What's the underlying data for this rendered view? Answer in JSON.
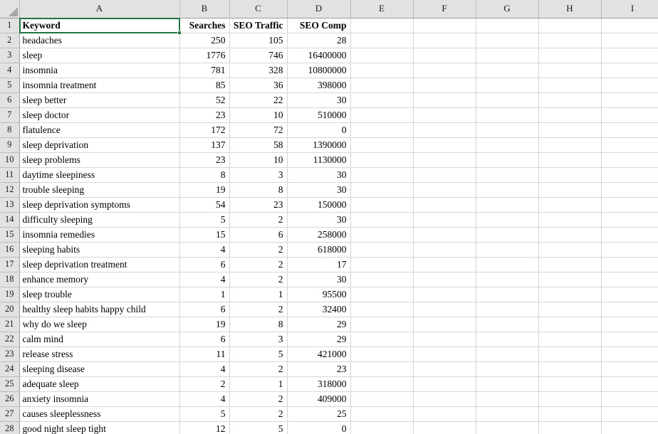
{
  "app": {
    "type": "spreadsheet",
    "select_all_label": "Select All",
    "active_cell": "A1",
    "selection_color": "#217346",
    "header_bg": "#e2e2e2",
    "gridline_color": "#d6d6d6"
  },
  "columns": [
    {
      "id": "A",
      "label": "A"
    },
    {
      "id": "B",
      "label": "B"
    },
    {
      "id": "C",
      "label": "C"
    },
    {
      "id": "D",
      "label": "D"
    },
    {
      "id": "E",
      "label": "E"
    },
    {
      "id": "F",
      "label": "F"
    },
    {
      "id": "G",
      "label": "G"
    },
    {
      "id": "H",
      "label": "H"
    },
    {
      "id": "I",
      "label": "I"
    }
  ],
  "header_row": {
    "number": "1",
    "cells": [
      "Keyword",
      "Searches",
      "SEO Traffic",
      "SEO Comp",
      "",
      "",
      "",
      "",
      ""
    ]
  },
  "rows": [
    {
      "number": "2",
      "cells": [
        "headaches",
        "250",
        "105",
        "28",
        "",
        "",
        "",
        "",
        ""
      ]
    },
    {
      "number": "3",
      "cells": [
        "sleep",
        "1776",
        "746",
        "16400000",
        "",
        "",
        "",
        "",
        ""
      ]
    },
    {
      "number": "4",
      "cells": [
        "insomnia",
        "781",
        "328",
        "10800000",
        "",
        "",
        "",
        "",
        ""
      ]
    },
    {
      "number": "5",
      "cells": [
        "insomnia treatment",
        "85",
        "36",
        "398000",
        "",
        "",
        "",
        "",
        ""
      ]
    },
    {
      "number": "6",
      "cells": [
        "sleep better",
        "52",
        "22",
        "30",
        "",
        "",
        "",
        "",
        ""
      ]
    },
    {
      "number": "7",
      "cells": [
        "sleep doctor",
        "23",
        "10",
        "510000",
        "",
        "",
        "",
        "",
        ""
      ]
    },
    {
      "number": "8",
      "cells": [
        "flatulence",
        "172",
        "72",
        "0",
        "",
        "",
        "",
        "",
        ""
      ]
    },
    {
      "number": "9",
      "cells": [
        "sleep deprivation",
        "137",
        "58",
        "1390000",
        "",
        "",
        "",
        "",
        ""
      ]
    },
    {
      "number": "10",
      "cells": [
        "sleep problems",
        "23",
        "10",
        "1130000",
        "",
        "",
        "",
        "",
        ""
      ]
    },
    {
      "number": "11",
      "cells": [
        "daytime sleepiness",
        "8",
        "3",
        "30",
        "",
        "",
        "",
        "",
        ""
      ]
    },
    {
      "number": "12",
      "cells": [
        "trouble sleeping",
        "19",
        "8",
        "30",
        "",
        "",
        "",
        "",
        ""
      ]
    },
    {
      "number": "13",
      "cells": [
        "sleep deprivation symptoms",
        "54",
        "23",
        "150000",
        "",
        "",
        "",
        "",
        ""
      ]
    },
    {
      "number": "14",
      "cells": [
        "difficulty sleeping",
        "5",
        "2",
        "30",
        "",
        "",
        "",
        "",
        ""
      ]
    },
    {
      "number": "15",
      "cells": [
        "insomnia remedies",
        "15",
        "6",
        "258000",
        "",
        "",
        "",
        "",
        ""
      ]
    },
    {
      "number": "16",
      "cells": [
        "sleeping habits",
        "4",
        "2",
        "618000",
        "",
        "",
        "",
        "",
        ""
      ]
    },
    {
      "number": "17",
      "cells": [
        "sleep deprivation treatment",
        "6",
        "2",
        "17",
        "",
        "",
        "",
        "",
        ""
      ]
    },
    {
      "number": "18",
      "cells": [
        "enhance memory",
        "4",
        "2",
        "30",
        "",
        "",
        "",
        "",
        ""
      ]
    },
    {
      "number": "19",
      "cells": [
        "sleep trouble",
        "1",
        "1",
        "95500",
        "",
        "",
        "",
        "",
        ""
      ]
    },
    {
      "number": "20",
      "cells": [
        "healthy sleep habits happy child",
        "6",
        "2",
        "32400",
        "",
        "",
        "",
        "",
        ""
      ]
    },
    {
      "number": "21",
      "cells": [
        "why do we sleep",
        "19",
        "8",
        "29",
        "",
        "",
        "",
        "",
        ""
      ]
    },
    {
      "number": "22",
      "cells": [
        "calm mind",
        "6",
        "3",
        "29",
        "",
        "",
        "",
        "",
        ""
      ]
    },
    {
      "number": "23",
      "cells": [
        "release stress",
        "11",
        "5",
        "421000",
        "",
        "",
        "",
        "",
        ""
      ]
    },
    {
      "number": "24",
      "cells": [
        "sleeping disease",
        "4",
        "2",
        "23",
        "",
        "",
        "",
        "",
        ""
      ]
    },
    {
      "number": "25",
      "cells": [
        "adequate sleep",
        "2",
        "1",
        "318000",
        "",
        "",
        "",
        "",
        ""
      ]
    },
    {
      "number": "26",
      "cells": [
        "anxiety insomnia",
        "4",
        "2",
        "409000",
        "",
        "",
        "",
        "",
        ""
      ]
    },
    {
      "number": "27",
      "cells": [
        "causes sleeplessness",
        "5",
        "2",
        "25",
        "",
        "",
        "",
        "",
        ""
      ]
    },
    {
      "number": "28",
      "cells": [
        "good night sleep tight",
        "12",
        "5",
        "0",
        "",
        "",
        "",
        "",
        ""
      ]
    }
  ]
}
